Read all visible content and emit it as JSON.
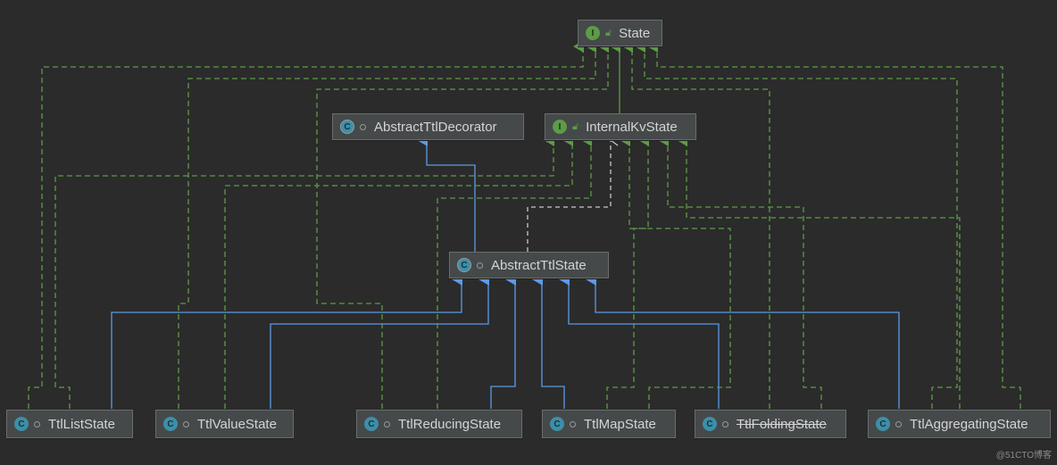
{
  "nodes": {
    "state": {
      "label": "State",
      "kind": "interface"
    },
    "internal_kv_state": {
      "label": "InternalKvState",
      "kind": "interface"
    },
    "abstract_ttl_decorator": {
      "label": "AbstractTtlDecorator",
      "kind": "abstract-class"
    },
    "abstract_ttl_state": {
      "label": "AbstractTtlState",
      "kind": "abstract-class"
    },
    "ttl_list_state": {
      "label": "TtlListState",
      "kind": "class"
    },
    "ttl_value_state": {
      "label": "TtlValueState",
      "kind": "class"
    },
    "ttl_reducing_state": {
      "label": "TtlReducingState",
      "kind": "class"
    },
    "ttl_map_state": {
      "label": "TtlMapState",
      "kind": "class"
    },
    "ttl_folding_state": {
      "label": "TtlFoldingState",
      "kind": "class",
      "deprecated": true
    },
    "ttl_aggregating_state": {
      "label": "TtlAggregatingState",
      "kind": "class"
    }
  },
  "badges": {
    "interface": "I",
    "class": "C"
  },
  "colors": {
    "extends": "#5a9ae6",
    "implements": "#5d9b47",
    "interface_extends": "#5d9b47",
    "dashed_realize": "#c8c8c8",
    "background": "#2b2b2b"
  },
  "watermark": "@51CTO博客"
}
